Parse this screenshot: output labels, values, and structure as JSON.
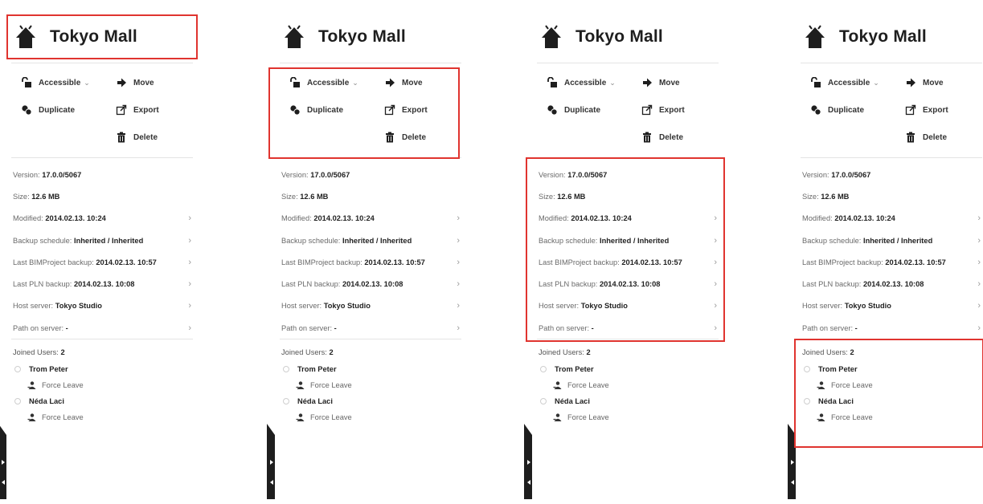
{
  "panel": {
    "title": "Tokyo Mall",
    "actions": {
      "accessible": "Accessible",
      "accessible_caret": "⌄",
      "move": "Move",
      "duplicate": "Duplicate",
      "export": "Export",
      "delete": "Delete"
    },
    "info": [
      {
        "label": "Version: ",
        "value": "17.0.0/5067",
        "chevron": false
      },
      {
        "label": "Size: ",
        "value": "12.6 MB",
        "chevron": false
      },
      {
        "label": "Modified: ",
        "value": "2014.02.13. 10:24",
        "chevron": true
      },
      {
        "label": "Backup schedule: ",
        "value": "Inherited / Inherited",
        "chevron": true
      },
      {
        "label": "Last BIMProject backup: ",
        "value": "2014.02.13. 10:57",
        "chevron": true
      },
      {
        "label": "Last PLN backup: ",
        "value": "2014.02.13. 10:08",
        "chevron": true
      },
      {
        "label": "Host server: ",
        "value": "Tokyo Studio",
        "chevron": true
      },
      {
        "label": "Path on server: ",
        "value": "-",
        "chevron": true
      }
    ],
    "users_label": "Joined Users: ",
    "users_count": "2",
    "users": [
      {
        "name": "Trom Peter",
        "action": "Force Leave"
      },
      {
        "name": "Néda Laci",
        "action": "Force Leave"
      }
    ],
    "chevron_glyph": "›",
    "side_tab_icons": [
      "arrow-right-icon",
      "arrow-left-icon"
    ]
  },
  "highlight_color": "#e0342f"
}
